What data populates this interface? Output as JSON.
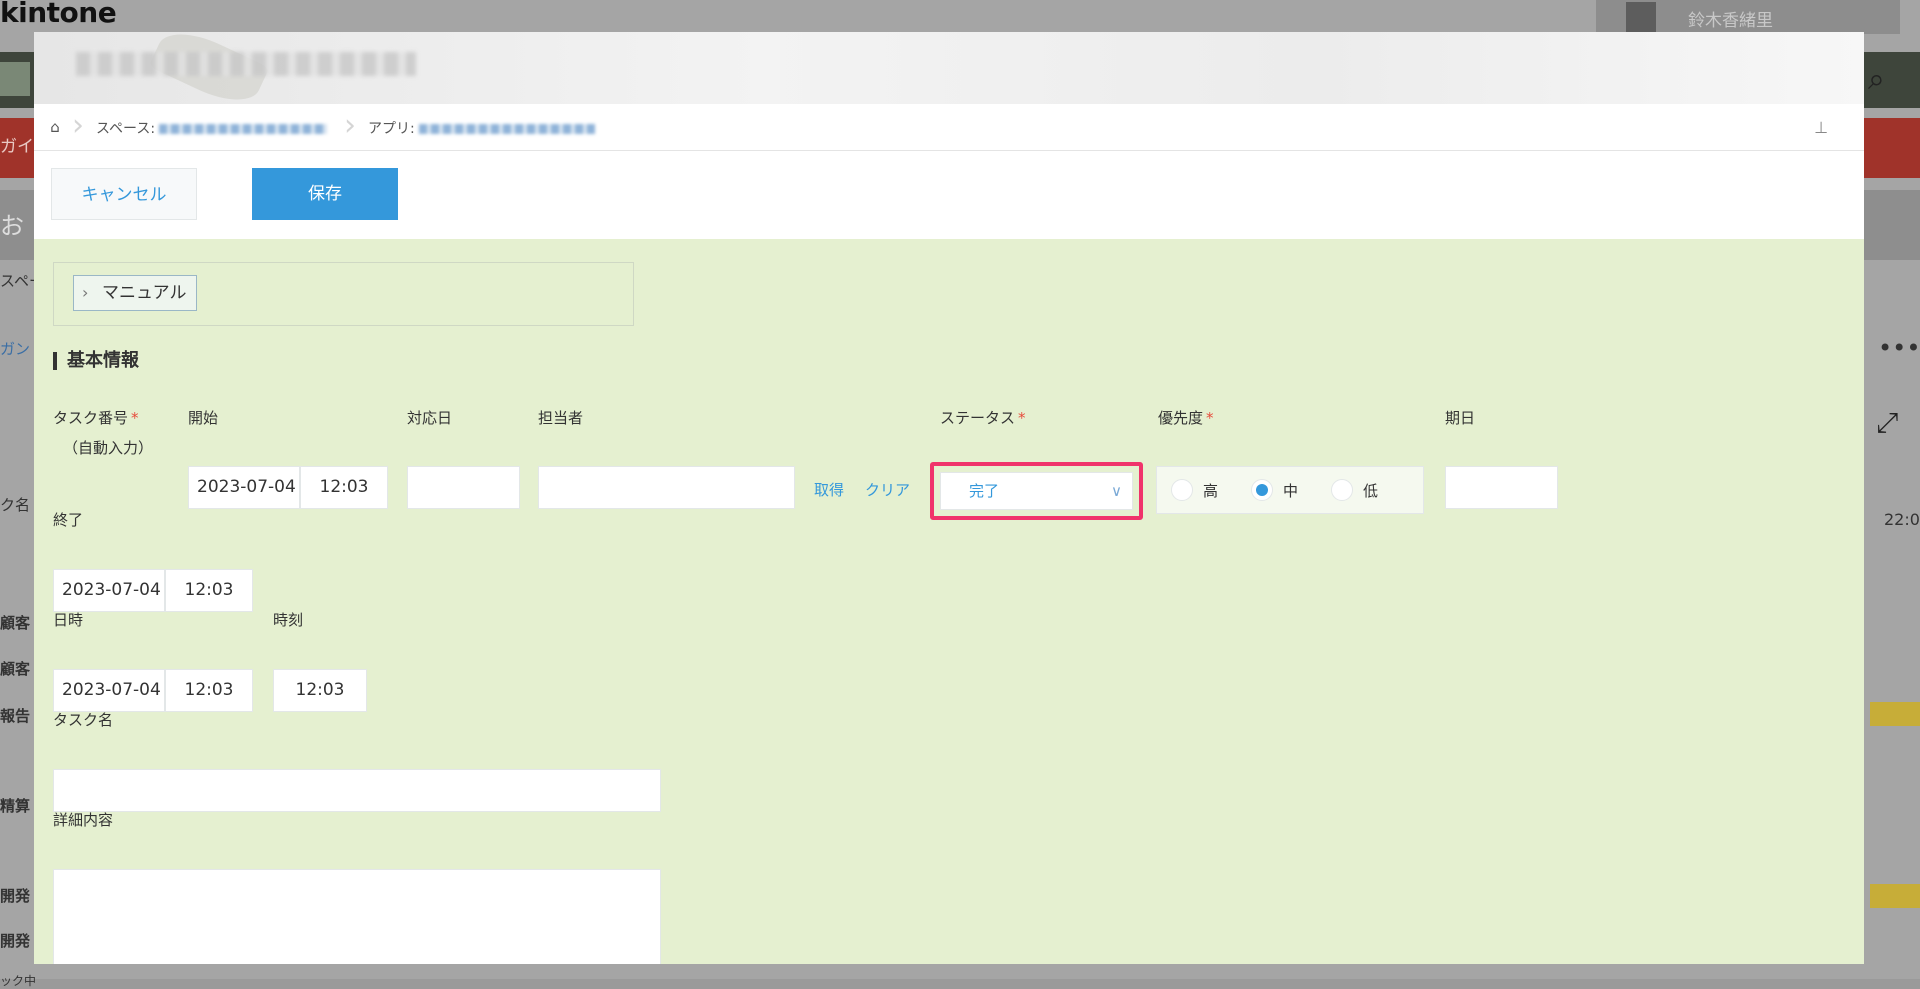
{
  "background": {
    "logo": "kintone",
    "user_name": "鈴木香緒里",
    "red_bar_text": "ガイ",
    "left_labels": [
      "お",
      "スペー",
      "ガン",
      "ク名",
      "顧客",
      "顧客",
      "報告",
      "精算",
      "開発",
      "開発",
      "ック中"
    ],
    "right_time": "22:0"
  },
  "breadcrumb": {
    "space_label": "スペース:",
    "app_label": "アプリ:"
  },
  "toolbar": {
    "cancel_label": "キャンセル",
    "save_label": "保存"
  },
  "manual": {
    "label": "マニュアル"
  },
  "section": {
    "title": "基本情報"
  },
  "fields": {
    "task_number": {
      "label": "タスク番号",
      "value": "（自動入力）"
    },
    "start": {
      "label": "開始",
      "date": "2023-07-04",
      "time": "12:03"
    },
    "response_date": {
      "label": "対応日",
      "value": ""
    },
    "assignee": {
      "label": "担当者",
      "value": "",
      "get_link": "取得",
      "clear_link": "クリア"
    },
    "status": {
      "label": "ステータス",
      "value": "完了"
    },
    "priority": {
      "label": "優先度",
      "options": [
        "高",
        "中",
        "低"
      ],
      "selected": "中"
    },
    "due_date": {
      "label": "期日",
      "value": ""
    },
    "end": {
      "label": "終了",
      "date": "2023-07-04",
      "time": "12:03"
    },
    "datetime": {
      "label": "日時",
      "date": "2023-07-04",
      "time": "12:03"
    },
    "time": {
      "label": "時刻",
      "value": "12:03"
    },
    "task_name": {
      "label": "タスク名",
      "value": ""
    },
    "details": {
      "label": "詳細内容",
      "value": ""
    }
  },
  "required_mark": "*",
  "colors": {
    "accent": "#3498db",
    "form_background": "#e5f0d0",
    "highlight": "#f0336b",
    "required": "#e74c3c"
  }
}
